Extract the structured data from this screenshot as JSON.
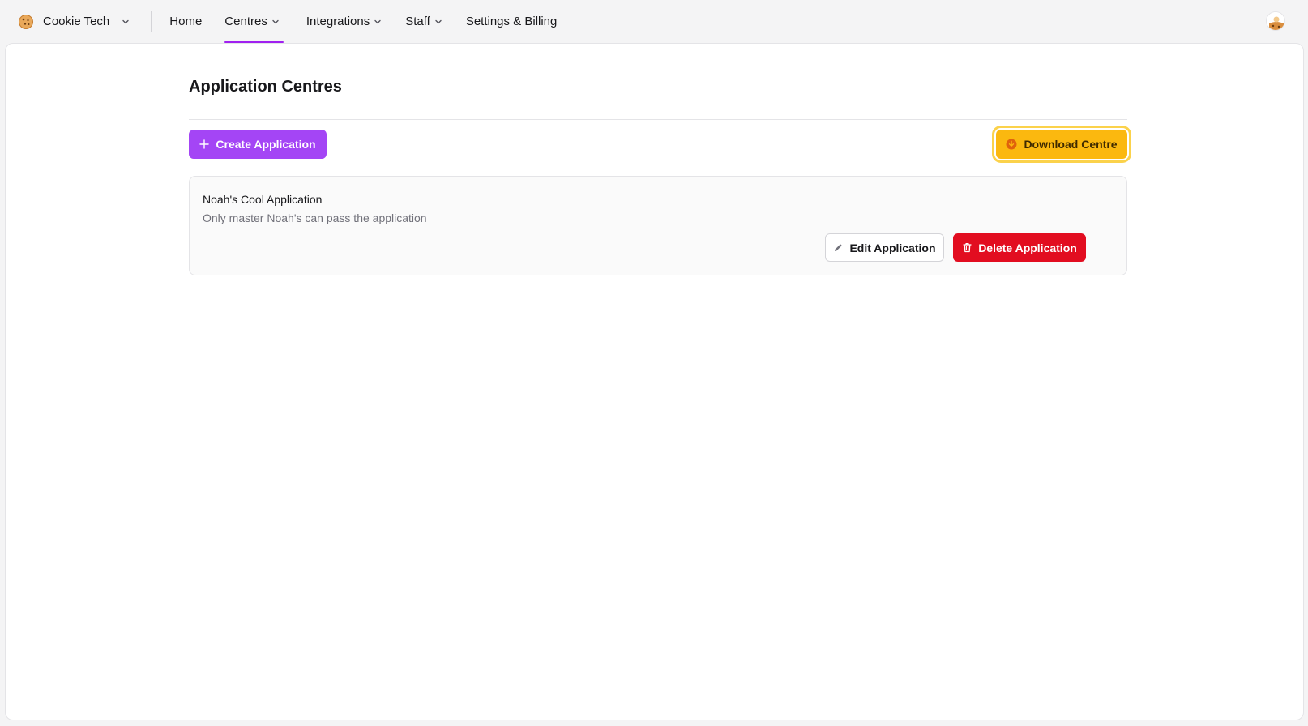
{
  "org": {
    "name": "Cookie Tech"
  },
  "nav": {
    "items": [
      {
        "label": "Home",
        "dropdown": false,
        "active": false
      },
      {
        "label": "Centres",
        "dropdown": true,
        "active": true
      },
      {
        "label": "Integrations",
        "dropdown": true,
        "active": false
      },
      {
        "label": "Staff",
        "dropdown": true,
        "active": false
      },
      {
        "label": "Settings & Billing",
        "dropdown": false,
        "active": false
      }
    ]
  },
  "page": {
    "title": "Application Centres"
  },
  "toolbar": {
    "create_label": "Create Application",
    "download_label": "Download Centre"
  },
  "applications": [
    {
      "name": "Noah's Cool Application",
      "description": "Only master Noah's can pass the application",
      "edit_label": "Edit Application",
      "delete_label": "Delete Application"
    }
  ],
  "colors": {
    "accent": "#a445f5",
    "active_tab": "#a020f0",
    "download": "#fbb80f",
    "danger": "#e20d20"
  },
  "icons": {
    "org_logo": "cookie-icon",
    "create": "plus-icon",
    "download": "download-circle-icon",
    "edit": "pencil-icon",
    "delete": "trash-icon",
    "dropdown": "chevron-down-icon"
  }
}
